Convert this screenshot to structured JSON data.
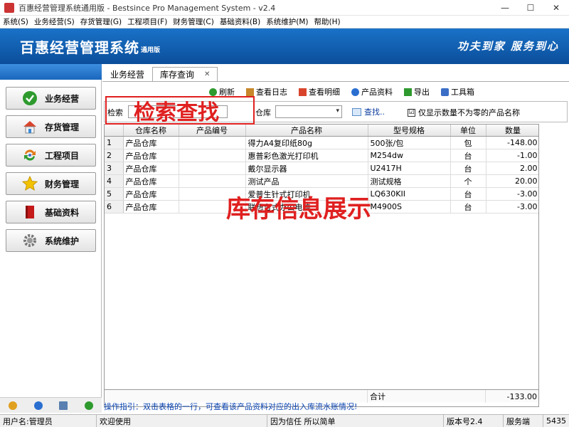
{
  "window": {
    "title": "百惠经营管理系统通用版 - Bestsince Pro Management System - v2.4",
    "minimize_label": "—",
    "maximize_label": "☐",
    "close_label": "✕"
  },
  "menu": [
    "系统(S)",
    "业务经营(S)",
    "存货管理(G)",
    "工程项目(F)",
    "财务管理(C)",
    "基础资料(B)",
    "系统维护(M)",
    "帮助(H)"
  ],
  "banner": {
    "title": "百惠经营管理系统",
    "edition": "通用版",
    "slogan": "功夫到家  服务到心"
  },
  "nav": [
    {
      "label": "业务经营",
      "icon": "check-circle-icon",
      "color": "#2e9a2e"
    },
    {
      "label": "存货管理",
      "icon": "house-icon",
      "color": "#d9452c"
    },
    {
      "label": "工程项目",
      "icon": "cycle-arrows-icon",
      "color": "#e07b1a"
    },
    {
      "label": "财务管理",
      "icon": "star-icon",
      "color": "#f2c200"
    },
    {
      "label": "基础资料",
      "icon": "book-icon",
      "color": "#c41a1a"
    },
    {
      "label": "系统维护",
      "icon": "gear-icon",
      "color": "#777777"
    }
  ],
  "tabs": [
    {
      "label": "业务经营",
      "active": false
    },
    {
      "label": "库存查询",
      "active": true
    }
  ],
  "tab_close": "✕",
  "toolbar": [
    {
      "label": "刷新",
      "icon": "refresh-icon",
      "color": "#2e9a2e"
    },
    {
      "label": "查看日志",
      "icon": "log-icon",
      "color": "#c8872a"
    },
    {
      "label": "查看明细",
      "icon": "house-icon",
      "color": "#d9452c"
    },
    {
      "label": "产品资料",
      "icon": "info-icon",
      "color": "#2a6ed0"
    },
    {
      "label": "导出",
      "icon": "export-icon",
      "color": "#2e9a2e"
    },
    {
      "label": "工具箱",
      "icon": "toolbox-icon",
      "color": "#3b6ec6"
    }
  ],
  "search": {
    "search_label": "检索",
    "search_value": "",
    "warehouse_label": "仓库",
    "warehouse_value": "",
    "find_label": "查找..",
    "nonzero_label": "仅显示数量不为零的产品名称",
    "nonzero_checked": "☑"
  },
  "annotations": {
    "search": "检索查找",
    "display": "库存信息展示"
  },
  "grid": {
    "columns": [
      "",
      "仓库名称",
      "产品编号",
      "产品名称",
      "型号规格",
      "单位",
      "数量"
    ],
    "rows": [
      [
        "1",
        "产品仓库",
        "",
        "得力A4复印纸80g",
        "500张/包",
        "包",
        "-148.00"
      ],
      [
        "2",
        "产品仓库",
        "",
        "惠普彩色激光打印机",
        "M254dw",
        "台",
        "-1.00"
      ],
      [
        "3",
        "产品仓库",
        "",
        "戴尔显示器",
        "U2417H",
        "台",
        "2.00"
      ],
      [
        "4",
        "产品仓库",
        "",
        "测试产品",
        "测试规格",
        "个",
        "20.00"
      ],
      [
        "5",
        "产品仓库",
        "",
        "爱普生针式打印机",
        "LQ630KII",
        "台",
        "-3.00"
      ],
      [
        "6",
        "产品仓库",
        "",
        "联想台式办公电脑",
        "M4900S",
        "台",
        "-3.00"
      ]
    ],
    "footer_label": "合计",
    "footer_total": "-133.00"
  },
  "guide": "操作指引：双击表格的一行，可查看该产品资料对应的出入库流水账情况!",
  "status": {
    "user": "用户名:管理员",
    "welcome": "欢迎使用",
    "motto": "因为信任  所以简单",
    "version": "版本号2.4",
    "mode": "服务端",
    "extra": "5435"
  }
}
